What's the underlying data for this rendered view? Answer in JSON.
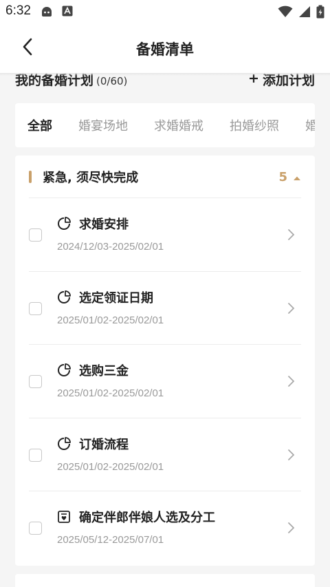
{
  "status_bar": {
    "time": "6:32",
    "icons": [
      "app-icon-face",
      "app-icon-a",
      "wifi-icon",
      "signal-icon",
      "battery-icon"
    ]
  },
  "header": {
    "back_icon": "chevron-left-icon",
    "title": "备婚清单"
  },
  "plan": {
    "title": "我的备婚计划",
    "count": "(0/60)",
    "add_label": "添加计划",
    "add_icon": "plus-icon"
  },
  "tabs": [
    {
      "label": "全部",
      "active": true
    },
    {
      "label": "婚宴场地",
      "active": false
    },
    {
      "label": "求婚婚戒",
      "active": false
    },
    {
      "label": "拍婚纱照",
      "active": false
    },
    {
      "label": "婚",
      "active": false
    }
  ],
  "group": {
    "title": "紧急, 须尽快完成",
    "count": "5",
    "expanded": true,
    "accent_color": "#c9a06a",
    "tasks": [
      {
        "title": "求婚安排",
        "date": "2024/12/03-2025/02/01",
        "icon": "pie-clock-icon",
        "checked": false
      },
      {
        "title": "选定领证日期",
        "date": "2025/01/02-2025/02/01",
        "icon": "pie-clock-icon",
        "checked": false
      },
      {
        "title": "选购三金",
        "date": "2025/01/02-2025/02/01",
        "icon": "pie-clock-icon",
        "checked": false
      },
      {
        "title": "订婚流程",
        "date": "2025/01/02-2025/02/01",
        "icon": "pie-clock-icon",
        "checked": false
      },
      {
        "title": "确定伴郎伴娘人选及分工",
        "date": "2025/05/12-2025/07/01",
        "icon": "heart-box-icon",
        "checked": false
      }
    ]
  }
}
